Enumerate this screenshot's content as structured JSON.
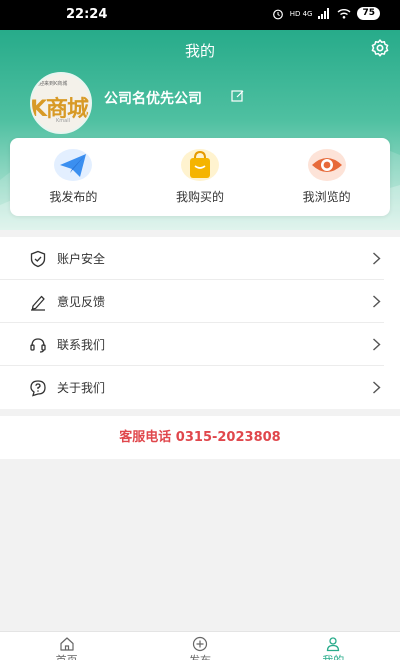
{
  "status_bar": {
    "time": "22:24",
    "network": "HD 4G",
    "battery": "75"
  },
  "header": {
    "title": "我的",
    "company_name": "公司名优先公司"
  },
  "avatar": {
    "ticker": "欢迎来到K商城",
    "logo_text": "K商城",
    "logo_sub": "Kmall"
  },
  "quick_actions": [
    {
      "label": "我发布的",
      "icon": "paper-plane-icon"
    },
    {
      "label": "我购买的",
      "icon": "shopping-bag-icon"
    },
    {
      "label": "我浏览的",
      "icon": "eye-icon"
    }
  ],
  "menu": [
    {
      "label": "账户安全",
      "icon": "shield-icon"
    },
    {
      "label": "意见反馈",
      "icon": "pen-icon"
    },
    {
      "label": "联系我们",
      "icon": "headset-icon"
    },
    {
      "label": "关于我们",
      "icon": "question-bubble-icon"
    }
  ],
  "service_phone": "客服电话 0315-2023808",
  "tabbar": [
    {
      "label": "首页",
      "icon": "home-icon",
      "active": false
    },
    {
      "label": "发布",
      "icon": "plus-circle-icon",
      "active": false
    },
    {
      "label": "我的",
      "icon": "user-icon",
      "active": true
    }
  ],
  "colors": {
    "brand": "#27ab8a",
    "phone": "#e0474c",
    "plane": "#3b8ff0",
    "bag": "#f5b400",
    "eye": "#e76a3a"
  }
}
